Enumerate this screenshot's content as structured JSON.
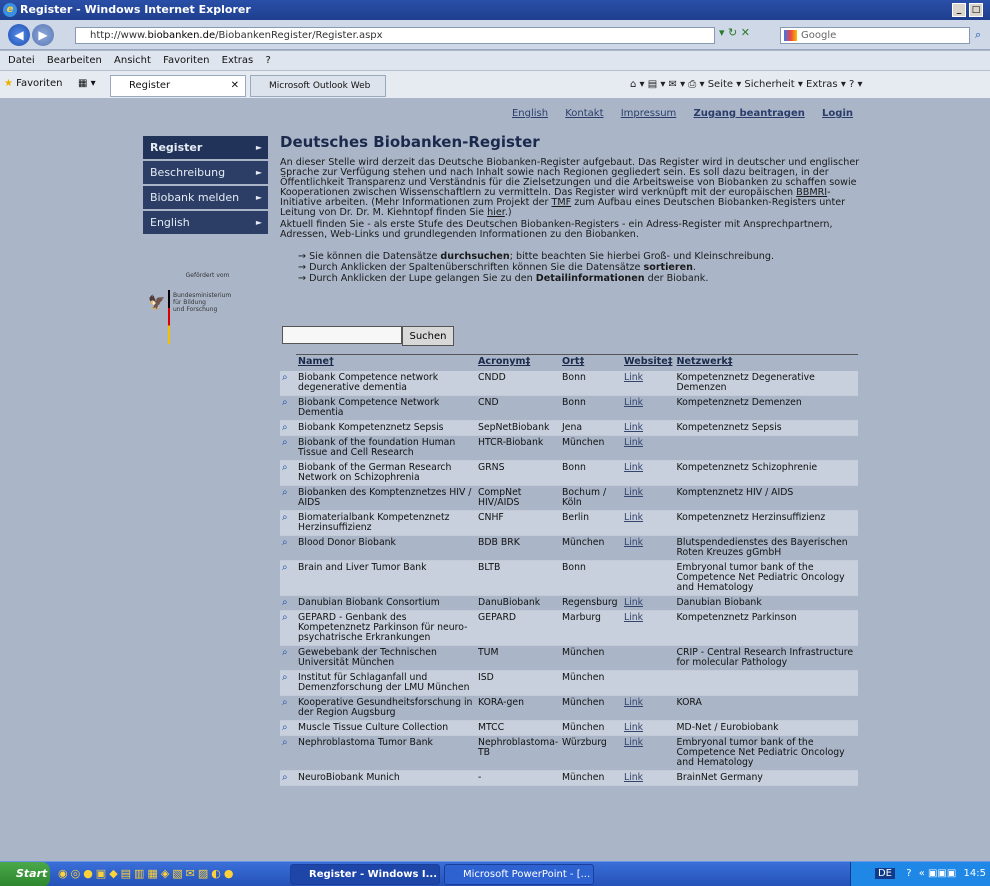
{
  "window": {
    "title": "Register - Windows Internet Explorer",
    "buttons": [
      "_",
      "Х"
    ]
  },
  "address": {
    "url_prefix": "http://www.",
    "url_domain": "biobanken.de",
    "url_path": "/BiobankenRegister/Register.aspx",
    "search_placeholder": "Google"
  },
  "menu": [
    "Datei",
    "Bearbeiten",
    "Ansicht",
    "Favoriten",
    "Extras",
    "?"
  ],
  "favbar": {
    "favorites_label": "Favoriten",
    "tab_active": "Register",
    "tab_other": "Microsoft Outlook Web Access",
    "commands": "Seite ▾  Sicherheit ▾  Extras ▾"
  },
  "toplinks": {
    "english": "English",
    "kontakt": "Kontakt",
    "impressum": "Impressum",
    "zugang": "Zugang beantragen",
    "login": "Login"
  },
  "sidebar": {
    "items": [
      {
        "label": "Register"
      },
      {
        "label": "Beschreibung"
      },
      {
        "label": "Biobank melden"
      },
      {
        "label": "English"
      }
    ]
  },
  "sponsor": {
    "gefoerdert": "Gefördert vom",
    "line1": "Bundesministerium",
    "line2": "für Bildung",
    "line3": "und Forschung"
  },
  "main": {
    "title": "Deutsches Biobanken-Register",
    "intro_a": "An dieser Stelle wird derzeit das Deutsche Biobanken-Register aufgebaut. Das Register wird in deutscher und englischer Sprache zur Verfügung stehen und nach Inhalt sowie nach Regionen gegliedert sein. Es soll dazu beitragen, in der Öffentlichkeit Transparenz und Verständnis für die Zielsetzungen und die Arbeitsweise von Biobanken zu schaffen sowie Kooperationen zwischen Wissenschaftlern zu vermitteln. Das Register wird verknüpft mit der europäischen ",
    "bbmri": "BBMRI",
    "intro_b": "-Initiative arbeiten. (Mehr Informationen zum Projekt der ",
    "tmf": "TMF",
    "intro_c": " zum Aufbau eines Deutschen Biobanken-Registers unter Leitung von Dr. Dr. M. Kiehntopf finden Sie ",
    "hier": "hier",
    "intro_d": ".)",
    "para2": "Aktuell finden Sie - als erste Stufe des Deutschen Biobanken-Registers - ein Adress-Register mit Ansprechpartnern, Adressen, Web-Links und grundlegenden Informationen zu den Biobanken.",
    "bullet1_a": "→ Sie können die Datensätze ",
    "bullet1_b": "durchsuchen",
    "bullet1_c": "; bitte beachten Sie hierbei Groß- und Kleinschreibung.",
    "bullet2_a": "→ Durch Anklicken der Spaltenüberschriften können Sie die Datensätze ",
    "bullet2_b": "sortieren",
    "bullet2_c": ".",
    "bullet3_a": "→ Durch Anklicken der Lupe gelangen Sie zu den ",
    "bullet3_b": "Detailinformationen",
    "bullet3_c": " der Biobank.",
    "search_value": "",
    "search_button": "Suchen"
  },
  "table": {
    "headers": [
      "Name†",
      "Acronym‡",
      "Ort‡",
      "Website‡",
      "Netzwerk‡"
    ],
    "rows": [
      {
        "name": "Biobank Competence network degenerative dementia",
        "acronym": "CNDD",
        "ort": "Bonn",
        "website": "Link",
        "netzwerk": "Kompetenznetz Degenerative Demenzen"
      },
      {
        "name": "Biobank Competence Network Dementia",
        "acronym": "CND",
        "ort": "Bonn",
        "website": "Link",
        "netzwerk": "Kompetenznetz Demenzen"
      },
      {
        "name": "Biobank Kompetenznetz Sepsis",
        "acronym": "SepNetBiobank",
        "ort": "Jena",
        "website": "Link",
        "netzwerk": "Kompetenznetz Sepsis"
      },
      {
        "name": "Biobank of the foundation Human Tissue and Cell Research",
        "acronym": "HTCR-Biobank",
        "ort": "München",
        "website": "Link",
        "netzwerk": ""
      },
      {
        "name": "Biobank of the German Research Network on Schizophrenia",
        "acronym": "GRNS",
        "ort": "Bonn",
        "website": "Link",
        "netzwerk": "Kompetenznetz Schizophrenie"
      },
      {
        "name": "Biobanken des Komptenznetzes HIV / AIDS",
        "acronym": "CompNet HIV/AIDS",
        "ort": "Bochum / Köln",
        "website": "Link",
        "netzwerk": "Komptenznetz HIV / AIDS"
      },
      {
        "name": "Biomaterialbank Kompetenznetz Herzinsuffizienz",
        "acronym": "CNHF",
        "ort": "Berlin",
        "website": "Link",
        "netzwerk": "Kompetenznetz Herzinsuffizienz"
      },
      {
        "name": "Blood Donor Biobank",
        "acronym": "BDB BRK",
        "ort": "München",
        "website": "Link",
        "netzwerk": "Blutspendedienstes des Bayerischen Roten Kreuzes gGmbH"
      },
      {
        "name": "Brain and Liver Tumor Bank",
        "acronym": "BLTB",
        "ort": "Bonn",
        "website": "",
        "netzwerk": "Embryonal tumor bank of the Competence Net Pediatric Oncology and Hematology"
      },
      {
        "name": "Danubian Biobank Consortium",
        "acronym": "DanuBiobank",
        "ort": "Regensburg",
        "website": "Link",
        "netzwerk": "Danubian Biobank"
      },
      {
        "name": "GEPARD - Genbank des Kompetenznetz Parkinson für neuro-psychatrische Erkrankungen",
        "acronym": "GEPARD",
        "ort": "Marburg",
        "website": "Link",
        "netzwerk": "Kompetenznetz Parkinson"
      },
      {
        "name": "Gewebebank der Technischen Universität München",
        "acronym": "TUM",
        "ort": "München",
        "website": "",
        "netzwerk": "CRIP - Central Research Infrastructure for molecular Pathology"
      },
      {
        "name": "Institut für Schlaganfall und Demenzforschung der LMU München",
        "acronym": "ISD",
        "ort": "München",
        "website": "",
        "netzwerk": ""
      },
      {
        "name": "Kooperative Gesundheitsforschung in der Region Augsburg",
        "acronym": "KORA-gen",
        "ort": "München",
        "website": "Link",
        "netzwerk": "KORA"
      },
      {
        "name": "Muscle Tissue Culture Collection",
        "acronym": "MTCC",
        "ort": "München",
        "website": "Link",
        "netzwerk": "MD-Net / Eurobiobank"
      },
      {
        "name": "Nephroblastoma Tumor Bank",
        "acronym": "Nephroblastoma-TB",
        "ort": "Würzburg",
        "website": "Link",
        "netzwerk": "Embryonal tumor bank of the Competence Net Pediatric Oncology and Hematology"
      },
      {
        "name": "NeuroBiobank Munich",
        "acronym": "-",
        "ort": "München",
        "website": "Link",
        "netzwerk": "BrainNet Germany"
      }
    ]
  },
  "taskbar": {
    "start": "Start",
    "task1": "Register - Windows I...",
    "task2": "Microsoft PowerPoint - [...",
    "tray_lang": "DE",
    "clock": "14:5"
  }
}
